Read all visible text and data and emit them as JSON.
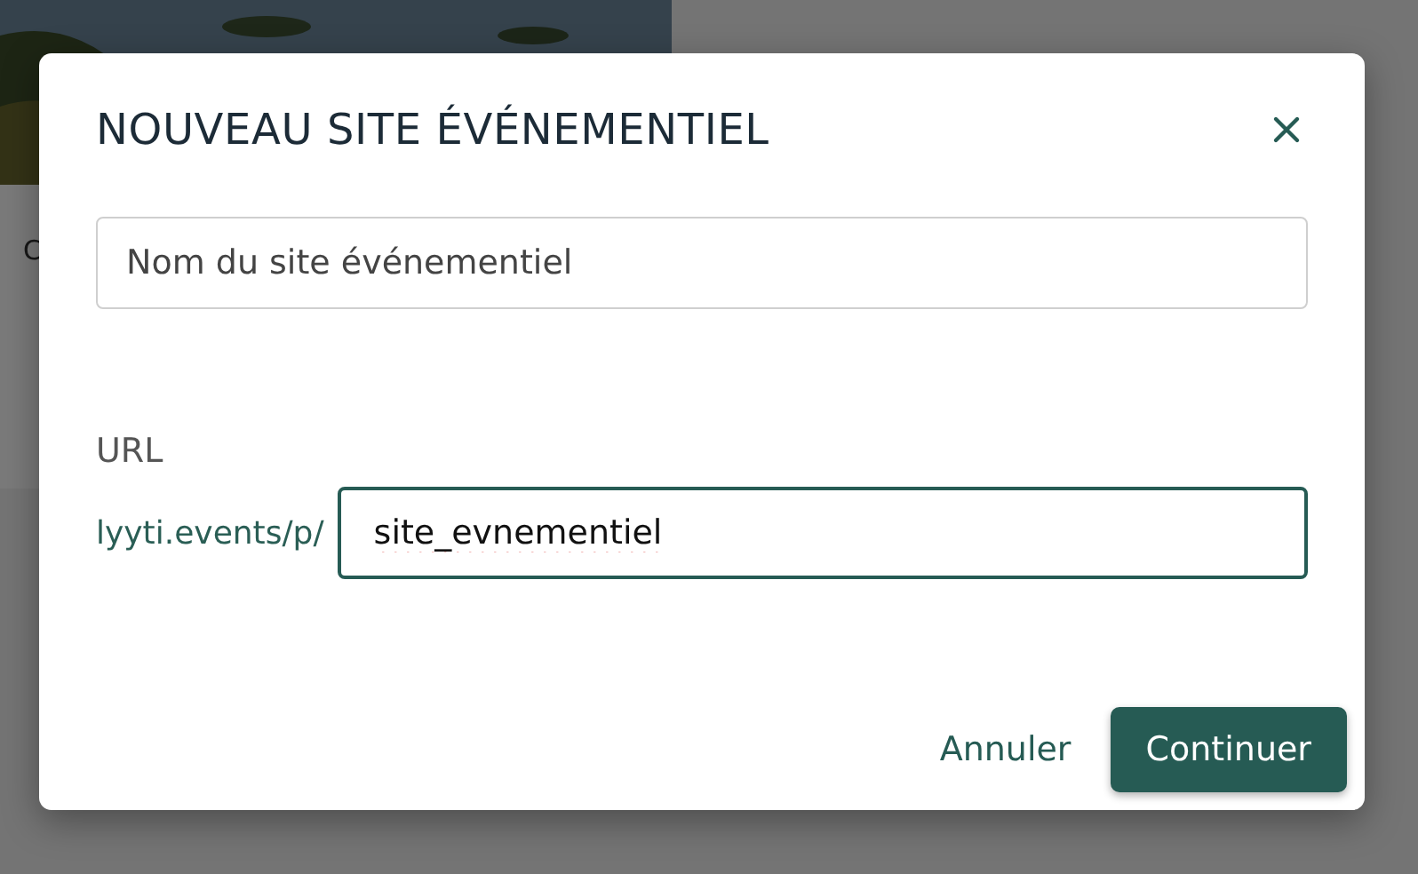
{
  "background_card": {
    "kind": "picture",
    "texts": [
      "C"
    ]
  },
  "dialog": {
    "title": "NOUVEAU SITE ÉVÉNEMENTIEL",
    "name_field": {
      "placeholder": "Nom du site événementiel"
    },
    "url_label": "URL",
    "url_prefix": "lyyti.events/p/",
    "slug_field": {
      "value": "site_evnementiel",
      "focused": true,
      "spelling_error": true
    },
    "buttons": [
      {
        "label": "Annuler",
        "kind": "link"
      },
      {
        "label": "Continuer",
        "kind": "primary"
      }
    ]
  }
}
